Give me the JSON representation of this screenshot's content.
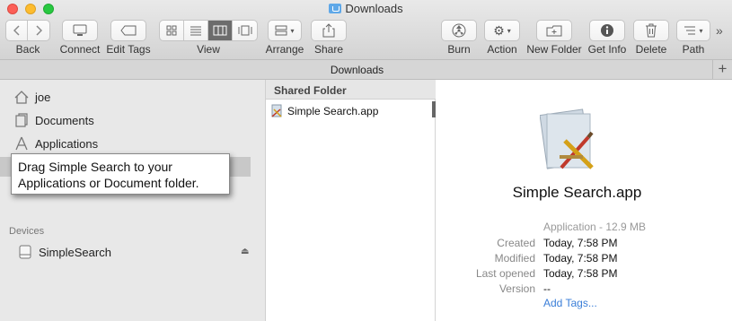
{
  "window": {
    "title": "Downloads"
  },
  "toolbar": {
    "back_label": "Back",
    "connect_label": "Connect",
    "edit_tags_label": "Edit Tags",
    "view_label": "View",
    "arrange_label": "Arrange",
    "share_label": "Share",
    "burn_label": "Burn",
    "action_label": "Action",
    "new_folder_label": "New Folder",
    "get_info_label": "Get Info",
    "delete_label": "Delete",
    "path_label": "Path",
    "active_view": "columns"
  },
  "tabbar": {
    "title": "Downloads",
    "add_tab_symbol": "+"
  },
  "sidebar": {
    "items": [
      {
        "label": "joe",
        "icon": "home-icon"
      },
      {
        "label": "Documents",
        "icon": "documents-icon"
      },
      {
        "label": "Applications",
        "icon": "applications-icon"
      }
    ],
    "devices_heading": "Devices",
    "devices": [
      {
        "label": "SimpleSearch",
        "icon": "disk-icon"
      }
    ]
  },
  "tooltip": {
    "text": "Drag Simple Search to your Applications or Document folder."
  },
  "column": {
    "header": "Shared Folder",
    "files": [
      {
        "name": "Simple Search.app"
      }
    ]
  },
  "preview": {
    "name": "Simple Search.app",
    "kind": "Application - 12.9 MB",
    "fields": [
      {
        "key": "Created",
        "value": "Today, 7:58 PM"
      },
      {
        "key": "Modified",
        "value": "Today, 7:58 PM"
      },
      {
        "key": "Last opened",
        "value": "Today, 7:58 PM"
      },
      {
        "key": "Version",
        "value": "--"
      }
    ],
    "add_tags_label": "Add Tags..."
  },
  "colors": {
    "accent_link": "#3a7ed8",
    "selected_view": "#6c6c6c"
  }
}
